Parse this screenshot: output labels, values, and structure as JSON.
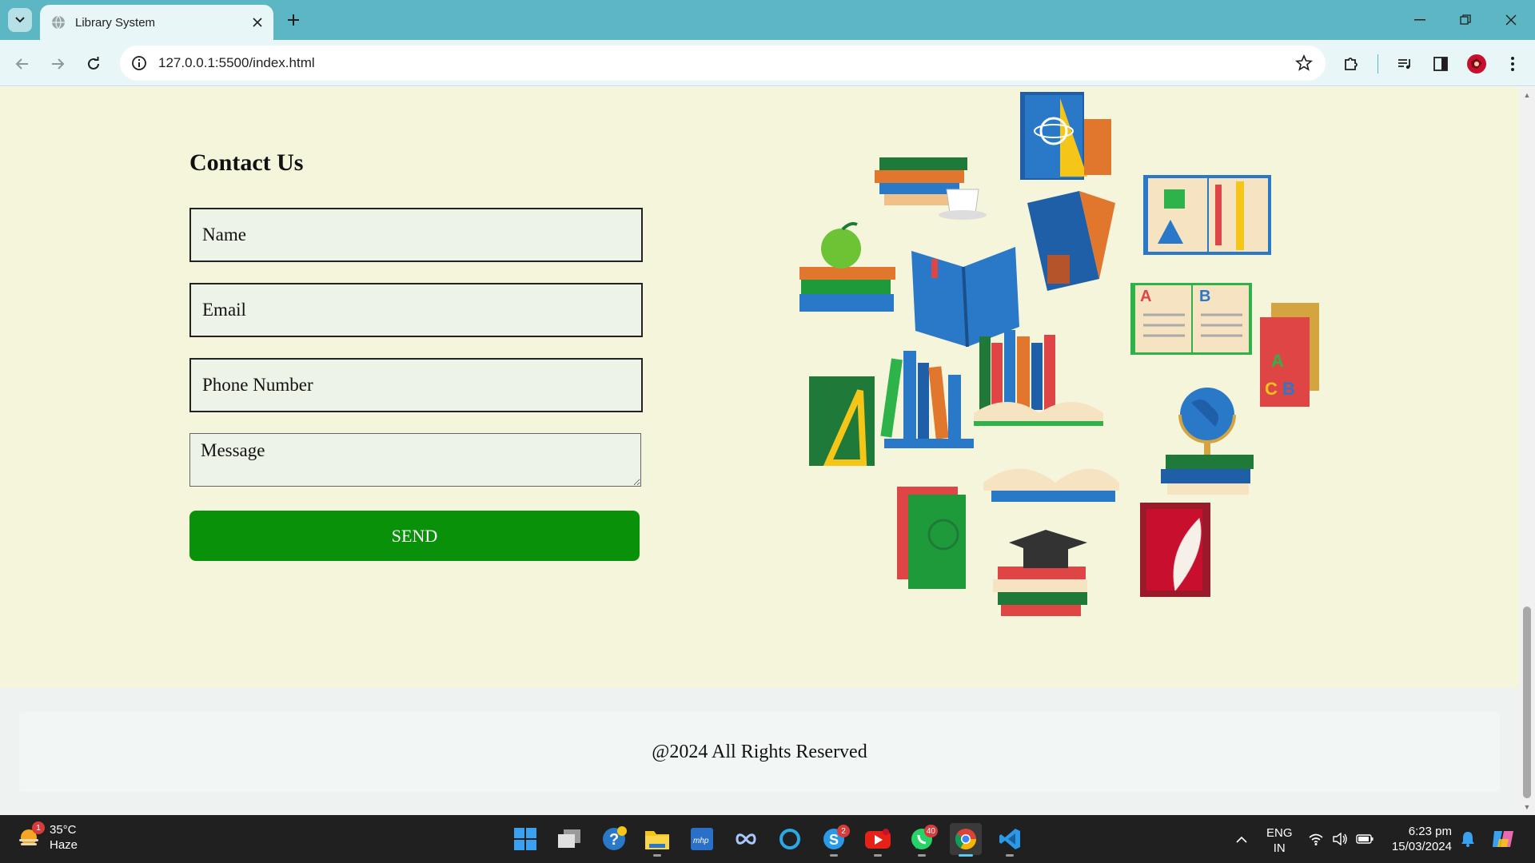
{
  "browser": {
    "tab_title": "Library System",
    "url": "127.0.0.1:5500/index.html"
  },
  "contact": {
    "title": "Contact Us",
    "name_placeholder": "Name",
    "email_placeholder": "Email",
    "phone_placeholder": "Phone Number",
    "message_placeholder": "Message",
    "send_label": "SEND"
  },
  "footer": {
    "copyright": "@2024 All Rights Reserved"
  },
  "taskbar": {
    "weather_temp": "35°C",
    "weather_desc": "Haze",
    "weather_badge": "1",
    "skype_badge": "2",
    "whatsapp_badge": "40",
    "lang_line1": "ENG",
    "lang_line2": "IN",
    "time": "6:23 pm",
    "date": "15/03/2024"
  },
  "colors": {
    "tabbar": "#5cb6c3",
    "page_bg": "#f5f5dc",
    "send_button": "#0a910a",
    "taskbar": "#202020"
  },
  "icons": [
    "tab-search-icon",
    "globe-icon",
    "close-icon",
    "plus-icon",
    "minimize-icon",
    "restore-icon",
    "back-icon",
    "forward-icon",
    "reload-icon",
    "site-info-icon",
    "star-icon",
    "extensions-icon",
    "media-icon",
    "sidepanel-icon",
    "profile-icon",
    "more-icon",
    "windows-start-icon",
    "task-view-icon",
    "help-icon",
    "file-explorer-icon",
    "vpn-icon",
    "meta-icon",
    "cortana-icon",
    "skype-icon",
    "youtube-icon",
    "whatsapp-icon",
    "chrome-icon",
    "vscode-icon",
    "wifi-icon",
    "volume-icon",
    "battery-icon",
    "bell-icon",
    "copilot-icon"
  ]
}
